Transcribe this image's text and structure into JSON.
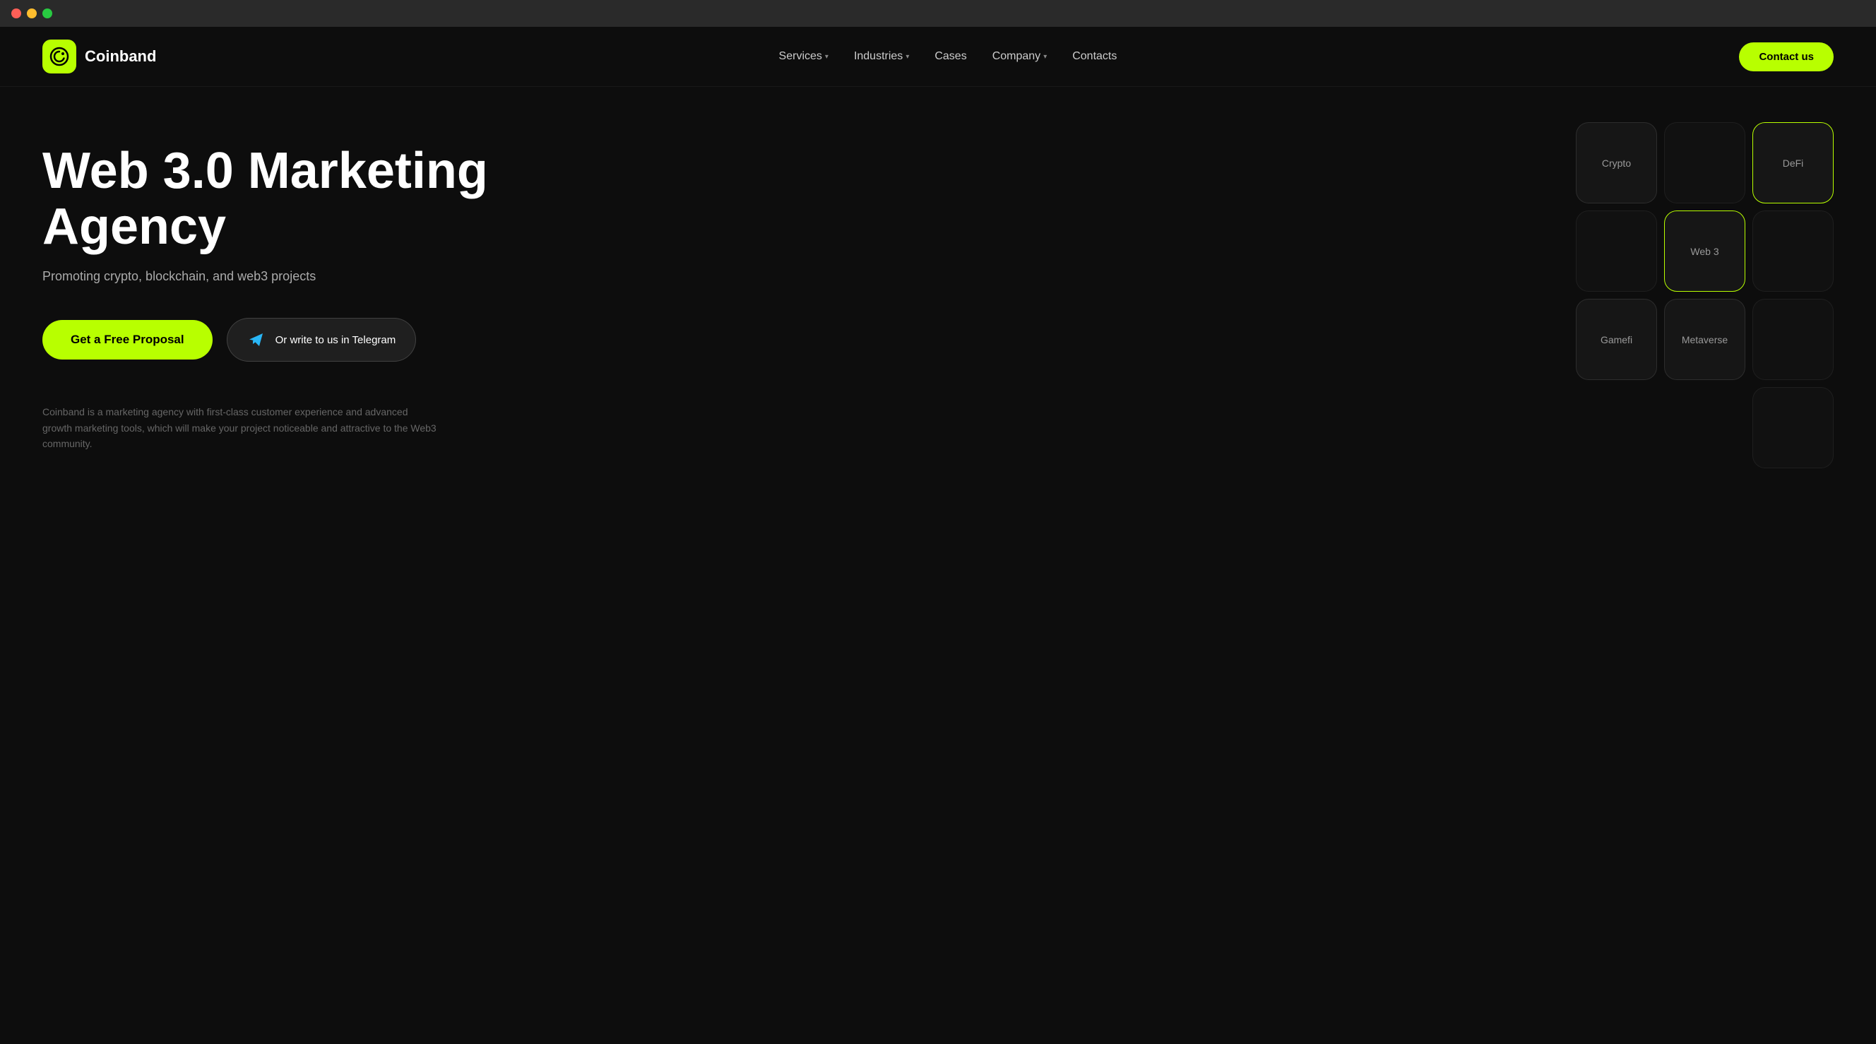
{
  "mac": {
    "dots": [
      "red",
      "yellow",
      "green"
    ]
  },
  "nav": {
    "brand": {
      "name": "Coinband"
    },
    "links": [
      {
        "label": "Services",
        "hasDropdown": true
      },
      {
        "label": "Industries",
        "hasDropdown": true
      },
      {
        "label": "Cases",
        "hasDropdown": false
      },
      {
        "label": "Company",
        "hasDropdown": true
      },
      {
        "label": "Contacts",
        "hasDropdown": false
      }
    ],
    "contact_button": "Contact us"
  },
  "hero": {
    "title_line1": "Web 3.0 Marketing",
    "title_line2": "Agency",
    "subtitle": "Promoting crypto, blockchain, and web3 projects",
    "proposal_button": "Get a Free Proposal",
    "telegram_button": "Or write to us in Telegram",
    "description": "Coinband is a marketing agency with first-class customer experience and advanced growth marketing tools, which will make your project noticeable and attractive to the Web3 community."
  },
  "industries": {
    "row1": [
      {
        "label": "Crypto",
        "highlighted": false,
        "empty": false
      },
      {
        "label": "",
        "highlighted": false,
        "empty": true
      },
      {
        "label": "DeFi",
        "highlighted": false,
        "empty": false
      }
    ],
    "row2": [
      {
        "label": "",
        "highlighted": false,
        "empty": true
      },
      {
        "label": "Web 3",
        "highlighted": true,
        "empty": false
      },
      {
        "label": "",
        "highlighted": false,
        "empty": true
      }
    ],
    "row3": [
      {
        "label": "Gamefi",
        "highlighted": false,
        "empty": false
      },
      {
        "label": "Metaverse",
        "highlighted": false,
        "empty": false
      },
      {
        "label": "",
        "highlighted": false,
        "empty": true
      }
    ],
    "row4": [
      {
        "label": "",
        "highlighted": false,
        "empty": true
      }
    ]
  },
  "colors": {
    "accent": "#b8ff00",
    "bg": "#0d0d0d",
    "nav_bg": "#2a2a2a"
  }
}
